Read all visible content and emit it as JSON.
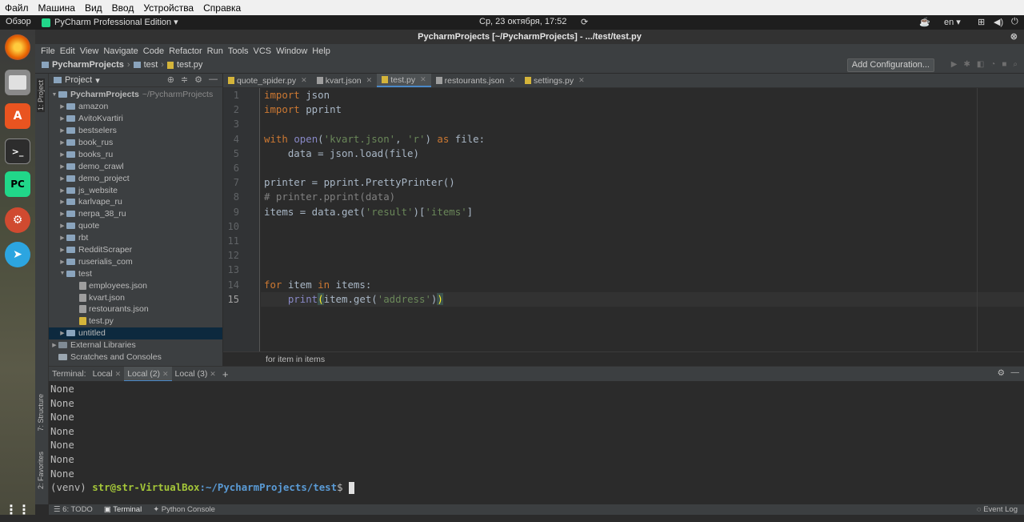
{
  "vbox_menu": [
    "Файл",
    "Машина",
    "Вид",
    "Ввод",
    "Устройства",
    "Справка"
  ],
  "topbar": {
    "activities": "Обзор",
    "app_name": "PyCharm Professional Edition",
    "clock": "Ср, 23 октября, 17:52",
    "lang": "en"
  },
  "window_title": "PycharmProjects [~/PycharmProjects] - .../test/test.py",
  "menu": [
    "File",
    "Edit",
    "View",
    "Navigate",
    "Code",
    "Refactor",
    "Run",
    "Tools",
    "VCS",
    "Window",
    "Help"
  ],
  "breadcrumbs": [
    "PycharmProjects",
    "test",
    "test.py"
  ],
  "add_config": "Add Configuration...",
  "project_panel": {
    "title": "Project",
    "root": {
      "name": "PycharmProjects",
      "path": "~/PycharmProjects"
    },
    "folders": [
      "amazon",
      "AvitoKvartiri",
      "bestselers",
      "book_rus",
      "books_ru",
      "demo_crawl",
      "demo_project",
      "js_website",
      "karlvape_ru",
      "nerpa_38_ru",
      "quote",
      "rbt",
      "RedditScraper",
      "ruserialis_com",
      "test"
    ],
    "test_files": [
      "employees.json",
      "kvart.json",
      "restourants.json",
      "test.py"
    ],
    "after": [
      "untitled"
    ],
    "external": "External Libraries",
    "scratches": "Scratches and Consoles"
  },
  "left_tabs": {
    "project": "1: Project",
    "structure": "7: Structure",
    "favorites": "2: Favorites"
  },
  "editor_tabs": [
    "quote_spider.py",
    "kvart.json",
    "test.py",
    "restourants.json",
    "settings.py"
  ],
  "line_numbers": [
    "1",
    "2",
    "3",
    "4",
    "5",
    "6",
    "7",
    "8",
    "9",
    "10",
    "11",
    "12",
    "13",
    "14",
    "15"
  ],
  "editor_breadcrumb": "for item in items",
  "terminal": {
    "label": "Terminal:",
    "tabs": [
      "Local",
      "Local (2)",
      "Local (3)"
    ],
    "output": [
      "None",
      "None",
      "None",
      "None",
      "None",
      "None",
      "None"
    ],
    "prompt_env": "(venv) ",
    "prompt_user": "str@str-VirtualBox",
    "prompt_path": ":~/PycharmProjects/test",
    "prompt_end": "$ "
  },
  "bottom_tabs": [
    "6: TODO",
    "Terminal",
    "Python Console"
  ],
  "event_log": "Event Log"
}
